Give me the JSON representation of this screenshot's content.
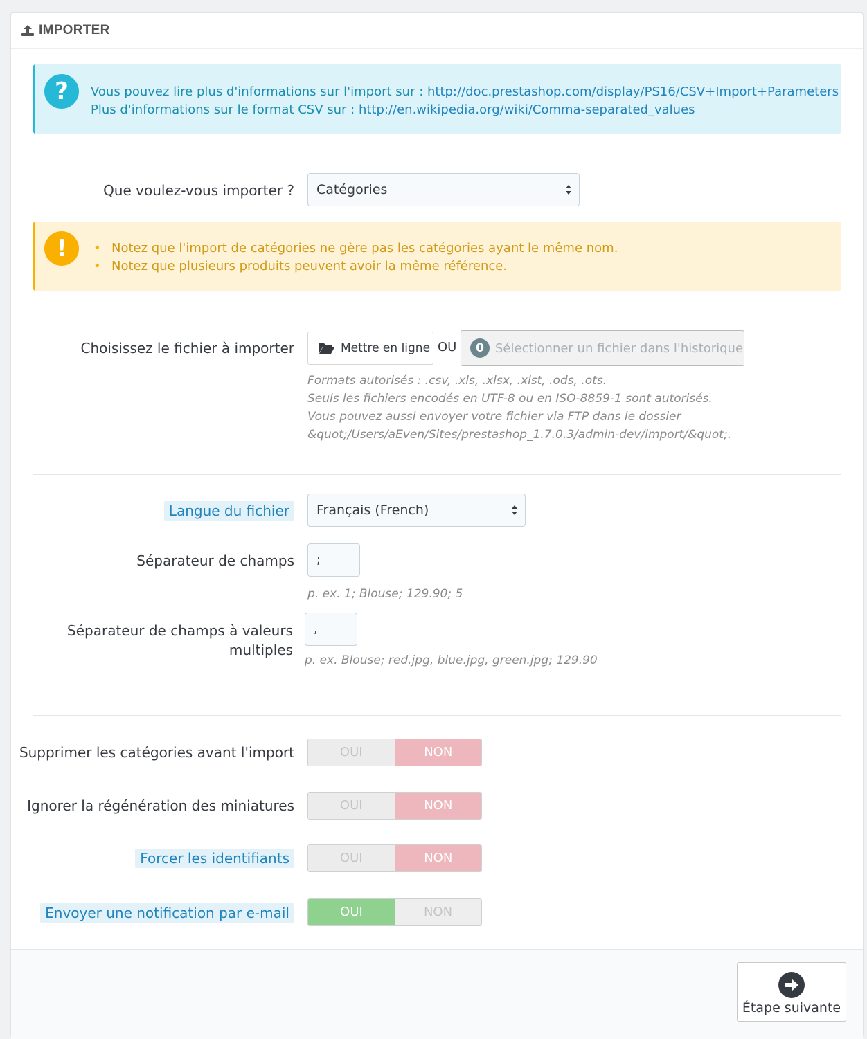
{
  "panel": {
    "title": "IMPORTER",
    "icon": "upload-icon"
  },
  "info_alert": {
    "icon": "question-icon",
    "line1_text": "Vous pouvez lire plus d'informations sur l'import sur : ",
    "line1_link": "http://doc.prestashop.com/display/PS16/CSV+Import+Parameters",
    "line2_text": "Plus d'informations sur le format CSV sur : ",
    "line2_link": "http://en.wikipedia.org/wiki/Comma-separated_values"
  },
  "import_type": {
    "label": "Que voulez-vous importer ?",
    "value": "Catégories"
  },
  "warning_alert": {
    "icon": "exclamation-icon",
    "items": [
      "Notez que l'import de catégories ne gère pas les catégories ayant le même nom.",
      "Notez que plusieurs produits peuvent avoir la même référence."
    ]
  },
  "file": {
    "label": "Choisissez le fichier à importer",
    "upload_button": "Mettre en ligne",
    "or_text": "OU",
    "history_badge": "0",
    "history_button": "Sélectionner un fichier dans l'historique",
    "help": [
      "Formats autorisés : .csv, .xls, .xlsx, .xlst, .ods, .ots.",
      "Seuls les fichiers encodés en UTF-8 ou en ISO-8859-1 sont autorisés.",
      "Vous pouvez aussi envoyer votre fichier via FTP dans le dossier",
      "&quot;/Users/aEven/Sites/prestashop_1.7.0.3/admin-dev/import/&quot;."
    ]
  },
  "language": {
    "label": "Langue du fichier",
    "value": "Français (French)"
  },
  "field_separator": {
    "label": "Séparateur de champs",
    "value": ";",
    "help": "p. ex. 1; Blouse; 129.90; 5"
  },
  "multi_separator": {
    "label_line1": "Séparateur de champs à valeurs",
    "label_line2": "multiples",
    "value": ",",
    "help": "p. ex. Blouse; red.jpg, blue.jpg, green.jpg; 129.90"
  },
  "switches": [
    {
      "label": "Supprimer les catégories avant l'import",
      "yes": "OUI",
      "no": "NON",
      "state": "no"
    },
    {
      "label": "Ignorer la régénération des miniatures",
      "yes": "OUI",
      "no": "NON",
      "state": "no"
    },
    {
      "label": "Forcer les identifiants",
      "yes": "OUI",
      "no": "NON",
      "state": "no"
    },
    {
      "label": "Envoyer une notification par e-mail",
      "yes": "OUI",
      "no": "NON",
      "state": "yes"
    }
  ],
  "footer": {
    "next_button": "Étape suivante",
    "next_icon": "arrow-right-circle-icon"
  }
}
